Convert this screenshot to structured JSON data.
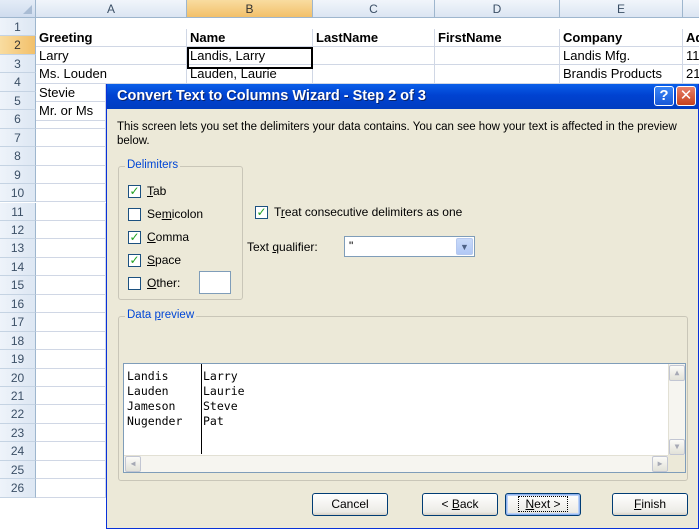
{
  "spreadsheet": {
    "columns": [
      "A",
      "B",
      "C",
      "D",
      "E"
    ],
    "active_column": "B",
    "rows": [
      "1",
      "2",
      "3",
      "4",
      "5",
      "6",
      "7",
      "8",
      "9",
      "10",
      "11",
      "12",
      "13",
      "14",
      "15",
      "16",
      "17",
      "18",
      "19",
      "20",
      "21",
      "22",
      "23",
      "24",
      "25",
      "26"
    ],
    "active_row": "2",
    "header_row": {
      "a": "Greeting",
      "b": "Name",
      "c": "LastName",
      "d": "FirstName",
      "e": "Company",
      "f": "Ad"
    },
    "data_rows": [
      {
        "a": "Larry",
        "b": "Landis, Larry",
        "e": "Landis Mfg.",
        "f": "11"
      },
      {
        "a": "Ms. Louden",
        "b": "Lauden, Laurie",
        "e": "Brandis Products",
        "f": "21"
      },
      {
        "a": "Stevie",
        "b": "",
        "e": "",
        "f": ""
      },
      {
        "a": "Mr. or Ms",
        "b": "",
        "e": "",
        "f": ""
      }
    ]
  },
  "dialog": {
    "title": "Convert Text to Columns Wizard - Step 2 of 3",
    "help_icon": "question-icon",
    "close_icon": "close-x-icon",
    "intro": "This screen lets you set the delimiters your data contains.  You can see how your text is affected in the preview below.",
    "delimiters": {
      "legend": "Delimiters",
      "tab": {
        "label": "Tab",
        "checked": true
      },
      "semicolon": {
        "label": "Semicolon",
        "checked": false
      },
      "comma": {
        "label": "Comma",
        "checked": true
      },
      "space": {
        "label": "Space",
        "checked": true
      },
      "other": {
        "label": "Other:",
        "checked": false,
        "value": ""
      }
    },
    "consecutive": {
      "label": "Treat consecutive delimiters as one",
      "checked": true
    },
    "qualifier": {
      "label": "Text qualifier:",
      "value": "\""
    },
    "preview": {
      "legend": "Data preview",
      "rows": [
        {
          "c1": "Landis",
          "c2": "Larry"
        },
        {
          "c1": "Lauden",
          "c2": "Laurie"
        },
        {
          "c1": "Jameson",
          "c2": "Steve"
        },
        {
          "c1": "Nugender",
          "c2": "Pat"
        }
      ]
    },
    "buttons": {
      "cancel": "Cancel",
      "back": "< Back",
      "next": "Next >",
      "finish": "Finish"
    }
  }
}
